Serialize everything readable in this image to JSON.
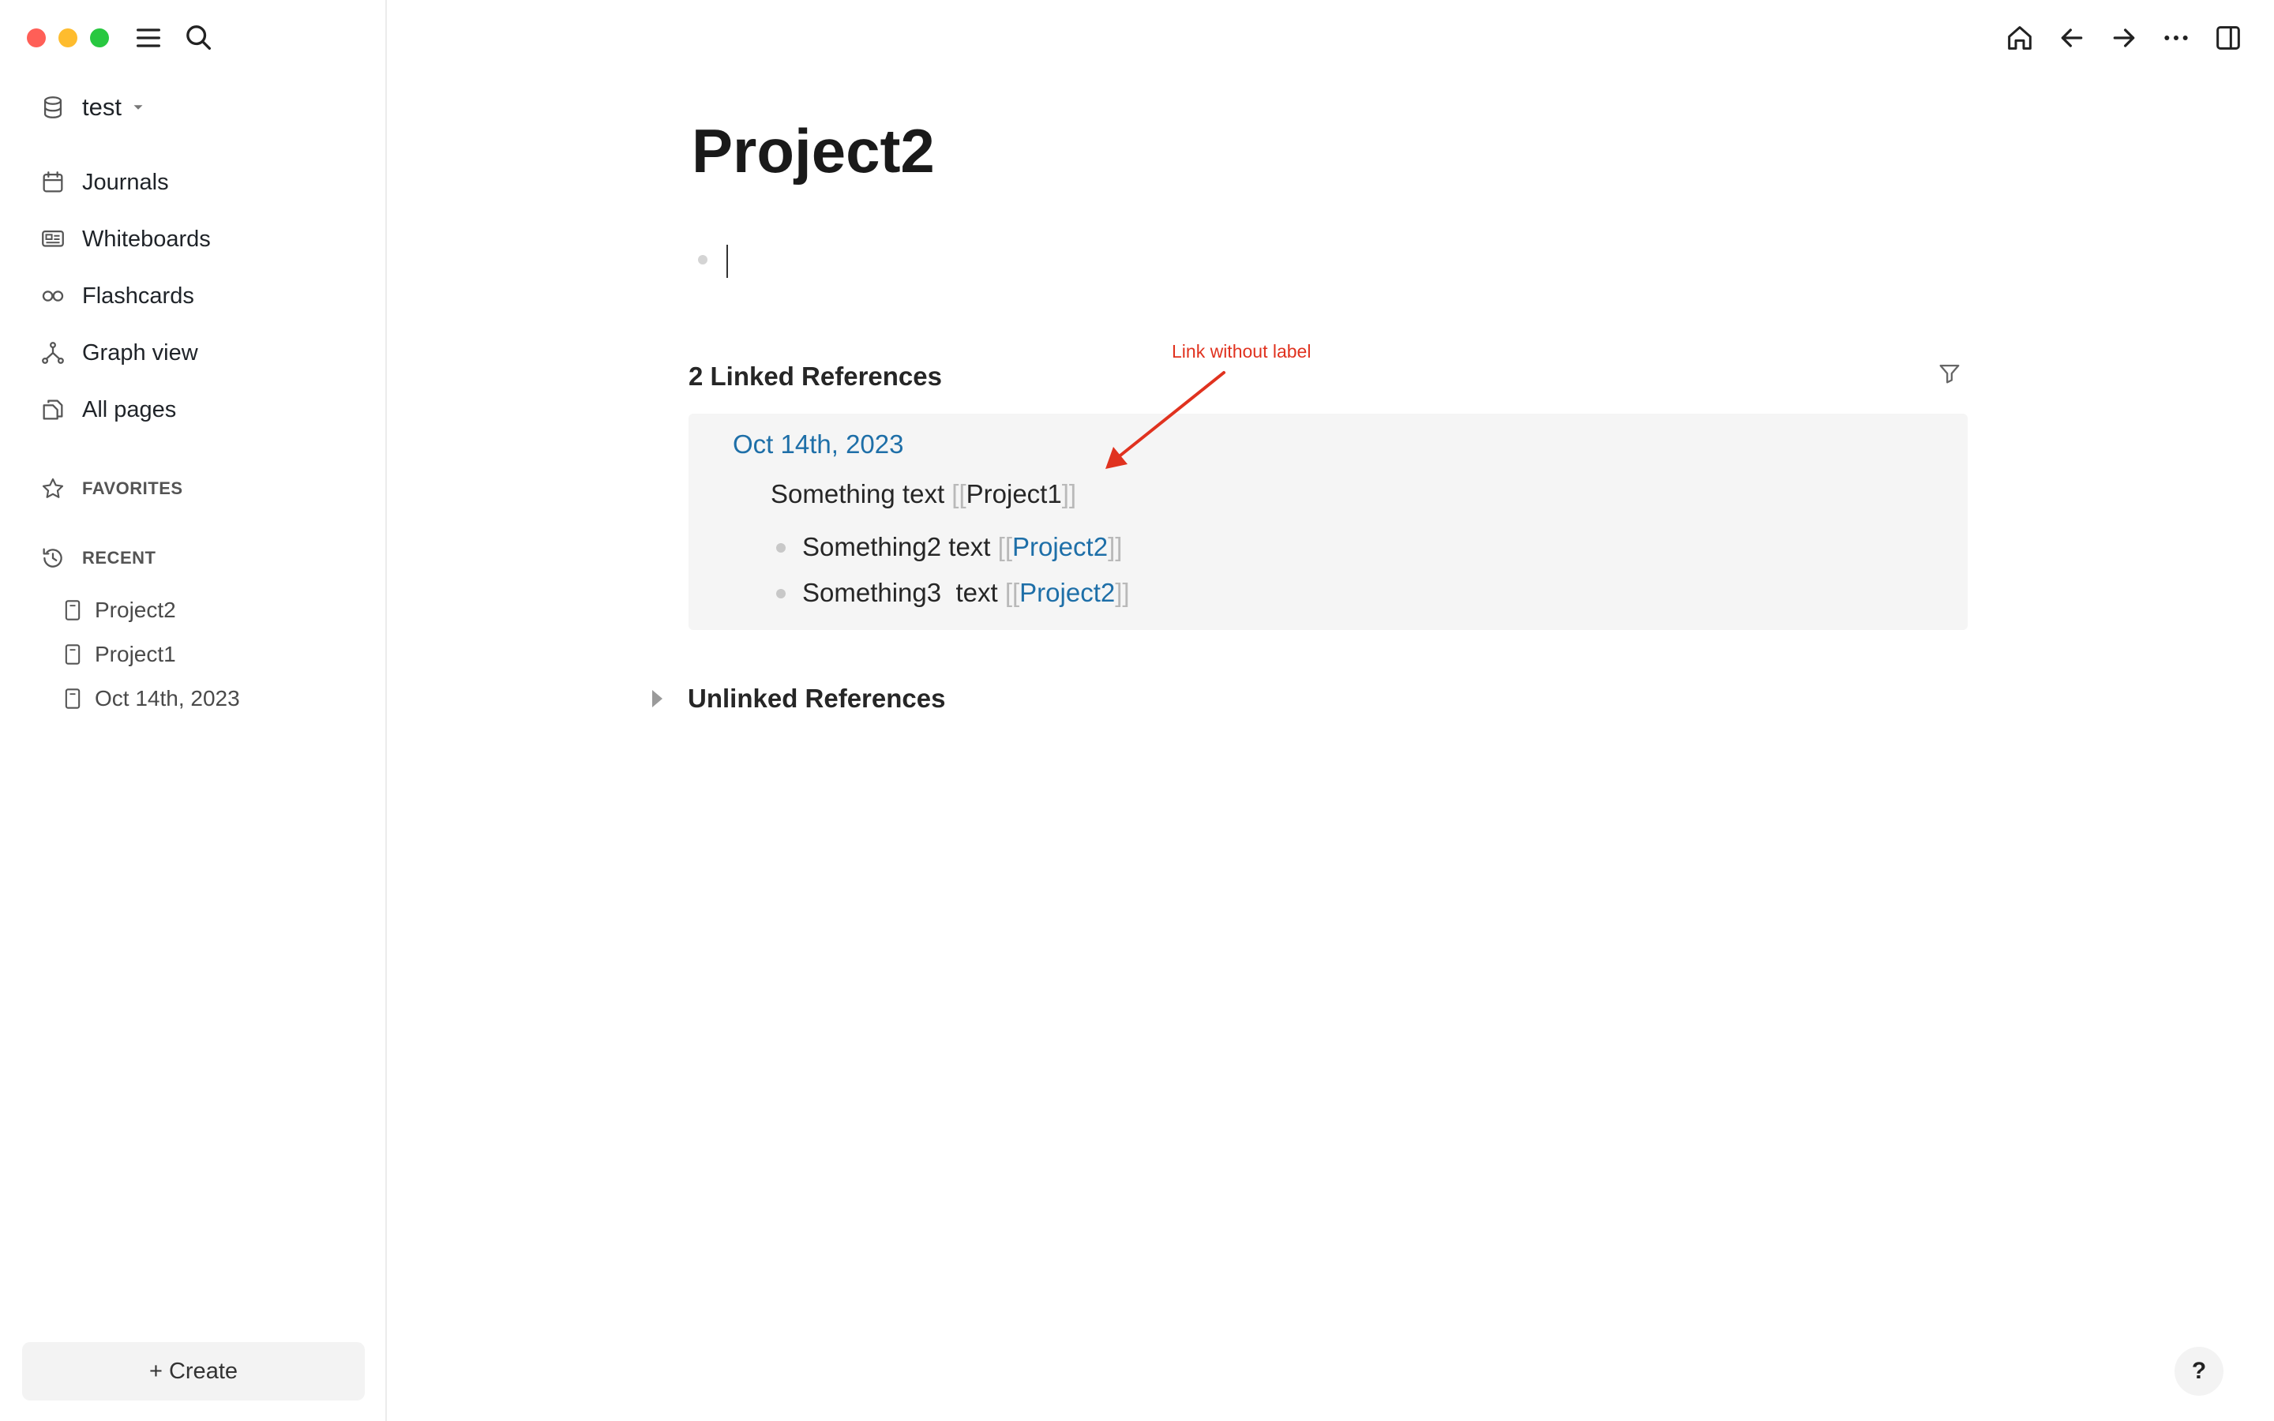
{
  "sidebar": {
    "graph_name": "test",
    "nav": [
      {
        "label": "Journals",
        "icon": "calendar-icon"
      },
      {
        "label": "Whiteboards",
        "icon": "whiteboard-icon"
      },
      {
        "label": "Flashcards",
        "icon": "infinity-icon"
      },
      {
        "label": "Graph view",
        "icon": "hierarchy-icon"
      },
      {
        "label": "All pages",
        "icon": "files-icon"
      }
    ],
    "favorites_title": "FAVORITES",
    "recent_title": "RECENT",
    "recent": [
      {
        "label": "Project2"
      },
      {
        "label": "Project1"
      },
      {
        "label": "Oct 14th, 2023"
      }
    ],
    "create_label": "+ Create"
  },
  "page": {
    "title": "Project2",
    "linked_refs_title": "2 Linked References",
    "ref": {
      "page": "Oct 14th, 2023",
      "line1_text": "Something text ",
      "line1_link": "Project1",
      "line2_text": "Something2 text ",
      "line2_link": "Project2",
      "line3_text": "Something3  text ",
      "line3_link": "Project2",
      "open_brackets": "[[",
      "close_brackets": "]]"
    },
    "unlinked_refs_title": "Unlinked References"
  },
  "annotation": {
    "text": "Link without label",
    "color": "#e0321f"
  },
  "help_label": "?",
  "colors": {
    "link": "#1e6fa8",
    "ref_background": "#f5f5f5"
  }
}
